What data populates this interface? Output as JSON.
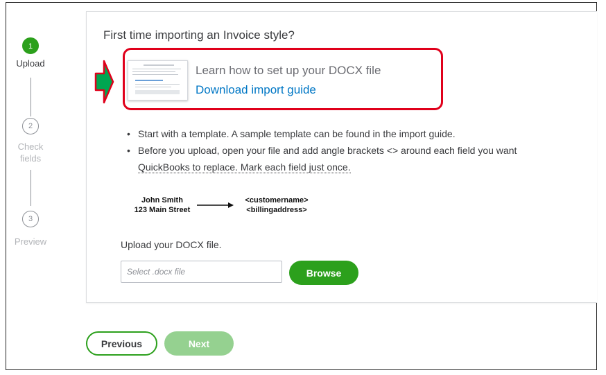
{
  "stepper": {
    "steps": [
      {
        "number": "1",
        "label": "Upload",
        "state": "active"
      },
      {
        "number": "2",
        "label_line1": "Check",
        "label_line2": "fields",
        "state": "inactive"
      },
      {
        "number": "3",
        "label": "Preview",
        "state": "inactive"
      }
    ]
  },
  "card": {
    "title": "First time importing an Invoice style?",
    "guide": {
      "learn_text": "Learn how to set up your DOCX file",
      "link_text": "Download import guide"
    },
    "bullets": [
      "Start with a template. A sample template can be found in the import guide.",
      "Before you upload, open your file and add angle brackets <> around each field you want",
      "QuickBooks to replace. Mark each field just once."
    ],
    "example": {
      "left_line1": "John Smith",
      "left_line2": "123 Main Street",
      "right_line1": "<customername>",
      "right_line2": "<billingaddress>"
    },
    "upload": {
      "label": "Upload your DOCX file.",
      "placeholder": "Select .docx file",
      "value": "",
      "browse_label": "Browse"
    }
  },
  "footer": {
    "previous_label": "Previous",
    "next_label": "Next"
  },
  "colors": {
    "accent": "#2ca01c",
    "accent_disabled": "#95d190",
    "link": "#0077c5",
    "highlight_border": "#e0001b",
    "annotation_arrow": "#00a651"
  },
  "icons": {
    "annotation": "right-pointing-arrow-icon",
    "example_arrow": "arrow-right-icon"
  }
}
